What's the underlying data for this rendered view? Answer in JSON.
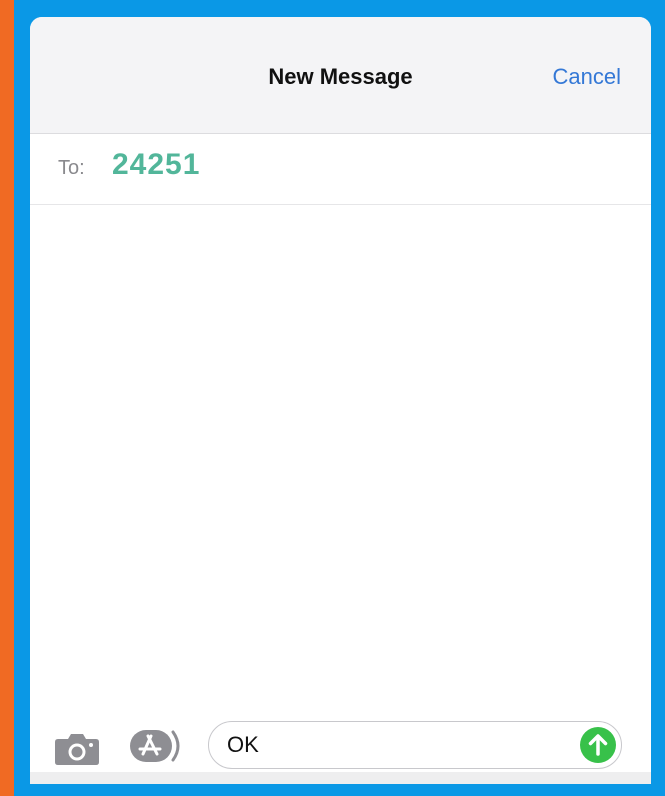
{
  "header": {
    "title": "New Message",
    "cancel_label": "Cancel"
  },
  "recipient": {
    "label": "To:",
    "value": "24251"
  },
  "composer": {
    "message_value": "OK",
    "camera_icon": "camera-icon",
    "apps_icon": "app-store-icon",
    "send_icon": "send-arrow-icon"
  },
  "colors": {
    "background": "#0a98e6",
    "accent_strip": "#f06a23",
    "link": "#3478d6",
    "recipient": "#52b69a",
    "send": "#38c14a"
  }
}
